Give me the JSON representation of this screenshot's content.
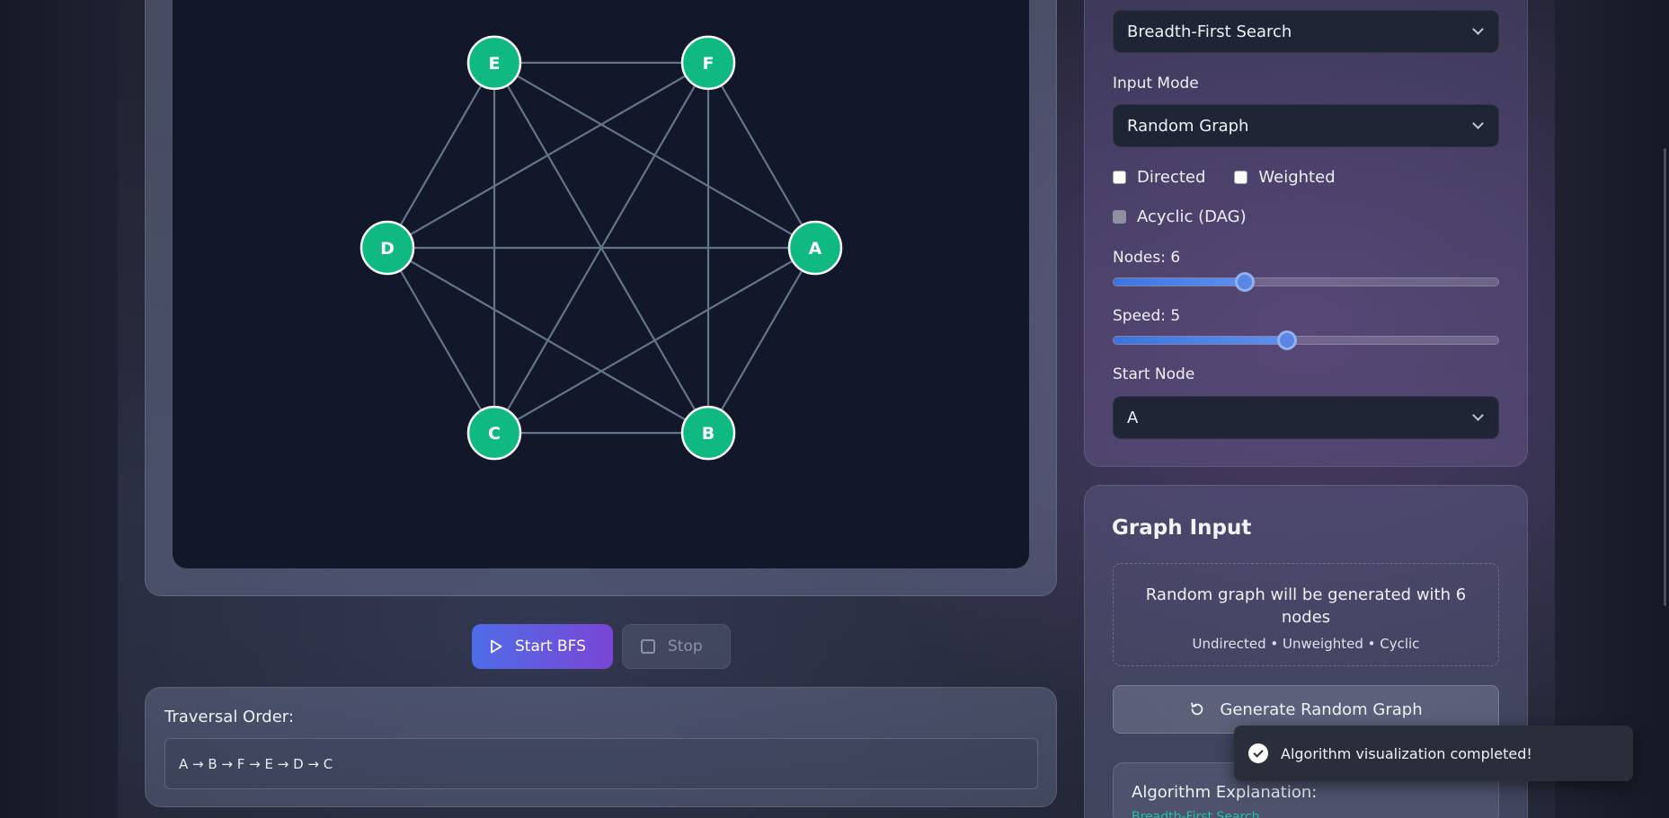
{
  "algorithm_select": {
    "value": "Breadth-First Search"
  },
  "input_mode": {
    "label": "Input Mode",
    "value": "Random Graph"
  },
  "options": {
    "directed": "Directed",
    "weighted": "Weighted",
    "acyclic": "Acyclic (DAG)"
  },
  "nodes_slider": {
    "label": "Nodes: 6",
    "value": 6,
    "fraction": 0.34
  },
  "speed_slider": {
    "label": "Speed: 5",
    "value": 5,
    "fraction": 0.45
  },
  "start_node": {
    "label": "Start Node",
    "value": "A"
  },
  "graph": {
    "nodes": [
      "A",
      "B",
      "C",
      "D",
      "E",
      "F"
    ],
    "edges": [
      [
        "A",
        "B"
      ],
      [
        "A",
        "C"
      ],
      [
        "A",
        "D"
      ],
      [
        "A",
        "E"
      ],
      [
        "A",
        "F"
      ],
      [
        "B",
        "C"
      ],
      [
        "B",
        "D"
      ],
      [
        "B",
        "E"
      ],
      [
        "B",
        "F"
      ],
      [
        "C",
        "D"
      ],
      [
        "C",
        "E"
      ],
      [
        "C",
        "F"
      ],
      [
        "D",
        "E"
      ],
      [
        "D",
        "F"
      ],
      [
        "E",
        "F"
      ]
    ],
    "node_color": "#10b981",
    "edge_color": "#64748b"
  },
  "buttons": {
    "start": "Start BFS",
    "stop": "Stop"
  },
  "traversal": {
    "title": "Traversal Order:",
    "order": "A → B → F → E → D → C"
  },
  "graph_input": {
    "title": "Graph Input",
    "description": "Random graph will be generated with 6 nodes",
    "properties": "Undirected • Unweighted • Cyclic",
    "generate_button": "Generate Random Graph"
  },
  "explanation": {
    "title": "Algorithm Explanation:",
    "subtitle": "Breadth-First Search"
  },
  "toast": {
    "message": "Algorithm visualization completed!"
  }
}
